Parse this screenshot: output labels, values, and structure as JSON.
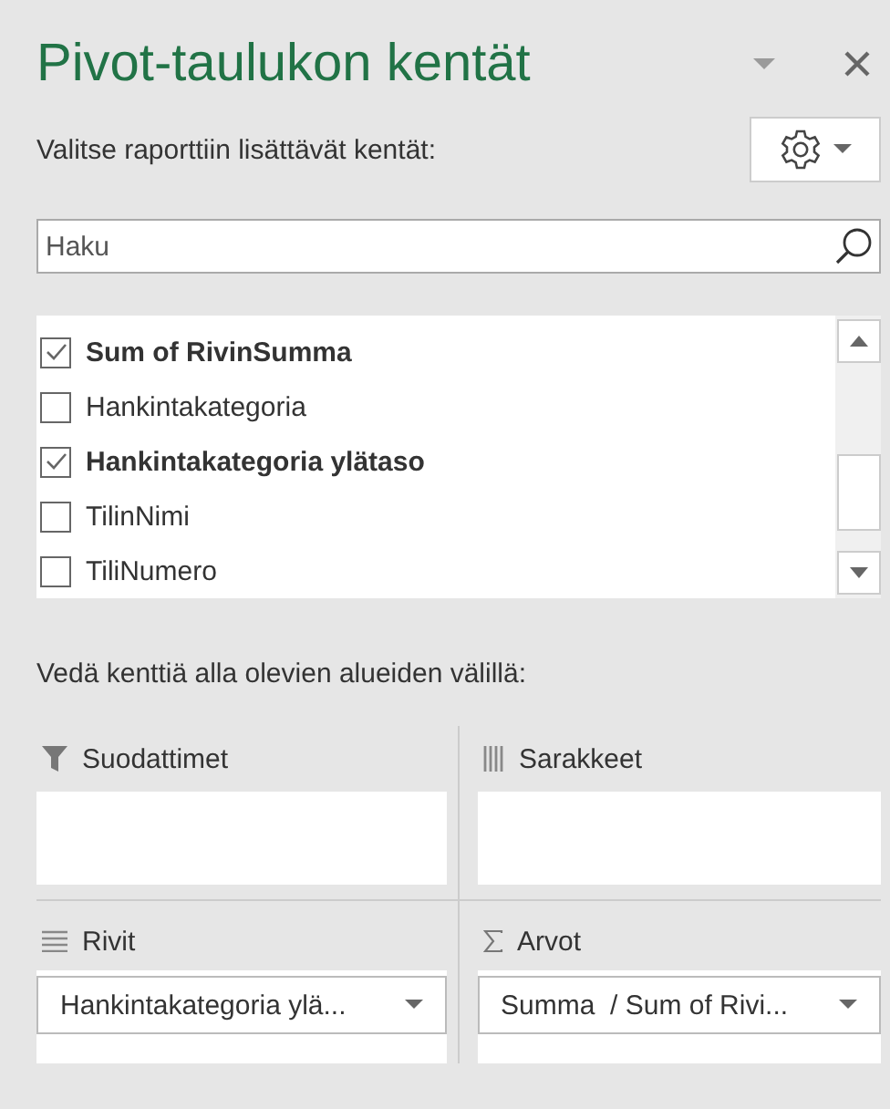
{
  "title": "Pivot-taulukon kentät",
  "subtitle": "Valitse raporttiin lisättävät kentät:",
  "search": {
    "placeholder": "Haku"
  },
  "fields": [
    {
      "label": "Sum of RivinSumma",
      "checked": true
    },
    {
      "label": "Hankintakategoria",
      "checked": false
    },
    {
      "label": "Hankintakategoria ylätaso",
      "checked": true
    },
    {
      "label": "TilinNimi",
      "checked": false
    },
    {
      "label": "TiliNumero",
      "checked": false
    }
  ],
  "areas_label": "Vedä kenttiä alla olevien alueiden välillä:",
  "areas": [
    {
      "kind": "filters",
      "label": "Suodattimet"
    },
    {
      "kind": "columns",
      "label": "Sarakkeet"
    },
    {
      "kind": "rows",
      "label": "Rivit",
      "fields": [
        "Hankintakategoria ylä..."
      ]
    },
    {
      "kind": "values",
      "label": "Arvot",
      "fields": [
        "Summa  / Sum of Rivi..."
      ]
    }
  ]
}
